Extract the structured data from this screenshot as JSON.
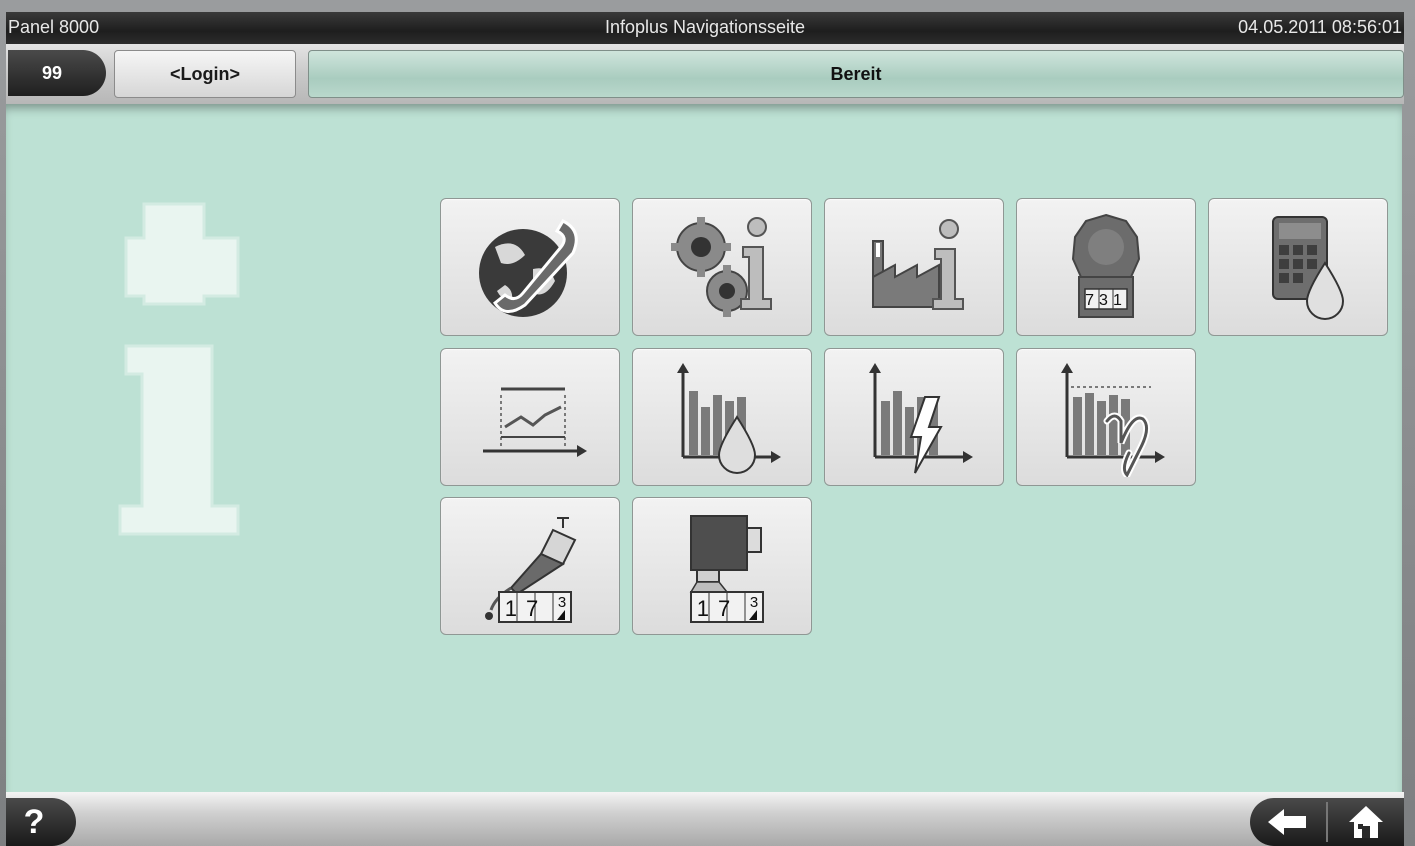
{
  "titlebar": {
    "app_name": "Panel 8000",
    "page_title": "Infoplus Navigationsseite",
    "datetime": "04.05.2011 08:56:01"
  },
  "statusrow": {
    "panel_number": "99",
    "login_label": "<Login>",
    "status_text": "Bereit"
  },
  "tiles": [
    {
      "icon": "globe-phone-icon"
    },
    {
      "icon": "gears-info-icon"
    },
    {
      "icon": "factory-info-icon"
    },
    {
      "icon": "meter-counter-icon"
    },
    {
      "icon": "calculator-drop-icon"
    },
    {
      "icon": "trend-chart-icon"
    },
    {
      "icon": "bar-chart-drop-icon"
    },
    {
      "icon": "bar-chart-lightning-icon"
    },
    {
      "icon": "bar-chart-efficiency-icon"
    },
    {
      "icon": "nozzle-counter-icon"
    },
    {
      "icon": "valve-counter-icon"
    }
  ],
  "counters": {
    "meter_digits": "731",
    "nozzle_digits": "17",
    "nozzle_last_top": "3",
    "valve_digits": "17",
    "valve_last_top": "3"
  },
  "bottombar": {
    "help_symbol": "?"
  },
  "colors": {
    "background": "#bde1d4",
    "titlebar": "#1e1e1e",
    "status_field": "#a9ccbf"
  }
}
